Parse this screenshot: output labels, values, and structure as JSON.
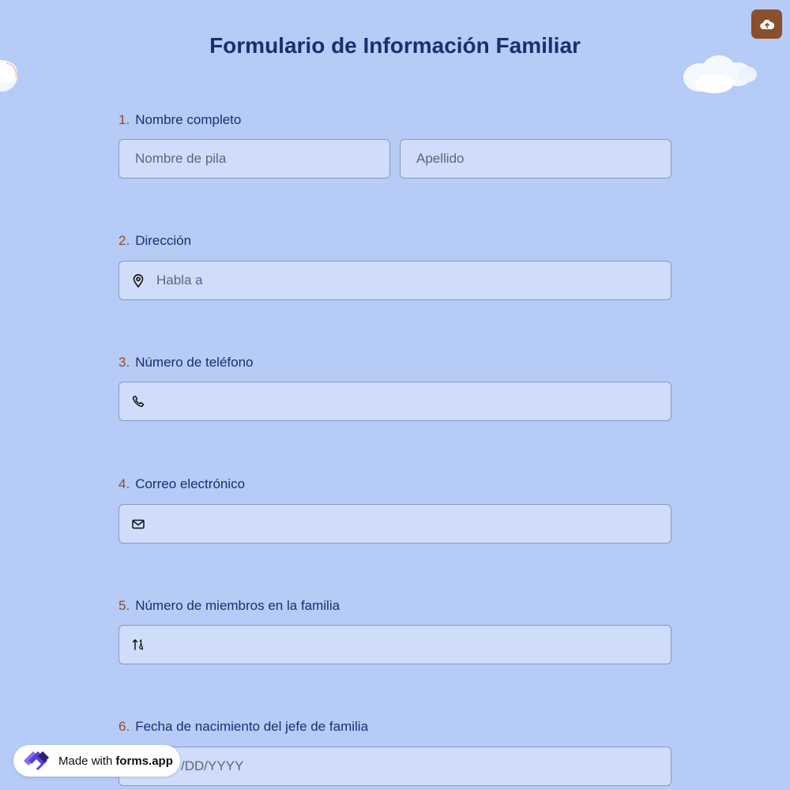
{
  "form": {
    "title": "Formulario de Información Familiar"
  },
  "upload_button": {
    "icon": "cloud-upload-icon",
    "color": "#8a4f2c"
  },
  "questions": [
    {
      "number": "1.",
      "label": "Nombre completo",
      "first_placeholder": "Nombre de pila",
      "last_placeholder": "Apellido"
    },
    {
      "number": "2.",
      "label": "Dirección",
      "placeholder": "Habla a",
      "icon": "location-pin-icon"
    },
    {
      "number": "3.",
      "label": "Número de teléfono",
      "placeholder": "",
      "icon": "phone-icon"
    },
    {
      "number": "4.",
      "label": "Correo electrónico",
      "placeholder": "",
      "icon": "mail-icon"
    },
    {
      "number": "5.",
      "label": "Número de miembros en la familia",
      "placeholder": "",
      "icon": "number-sort-icon"
    },
    {
      "number": "6.",
      "label": "Fecha de nacimiento del jefe de familia",
      "placeholder": "MM/DD/YYYY",
      "visible_placeholder": "/DD/YYYY"
    }
  ],
  "badge": {
    "prefix": "Made with",
    "brand": "forms.app"
  },
  "colors": {
    "background": "#b6cbf6",
    "field_background": "#cfdcfa",
    "accent": "#8a4f2c",
    "text": "#1b2f6d"
  }
}
